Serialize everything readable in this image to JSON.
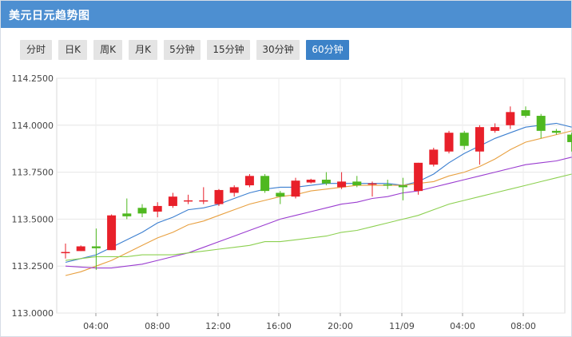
{
  "title": "美元日元趋势图",
  "tabs": [
    {
      "label": "分时",
      "active": false
    },
    {
      "label": "日K",
      "active": false
    },
    {
      "label": "周K",
      "active": false
    },
    {
      "label": "月K",
      "active": false
    },
    {
      "label": "5分钟",
      "active": false
    },
    {
      "label": "15分钟",
      "active": false
    },
    {
      "label": "30分钟",
      "active": false
    },
    {
      "label": "60分钟",
      "active": true
    }
  ],
  "colors": {
    "header": "#4d8fd1",
    "active_tab": "#3c82c8",
    "up": "#e8202a",
    "down": "#4fb820",
    "ma5": "#3c7fd0",
    "ma10": "#e8a040",
    "ma20": "#9a3cd0",
    "ma30": "#8cd050"
  },
  "chart_data": {
    "type": "candlestick",
    "ylim": [
      113.0,
      114.25
    ],
    "yticks": [
      "114.2500",
      "114.0000",
      "113.7500",
      "113.5000",
      "113.2500",
      "113.0000"
    ],
    "xticks": [
      "04:00",
      "08:00",
      "12:00",
      "16:00",
      "20:00",
      "11/09",
      "04:00",
      "08:00"
    ],
    "candles": [
      {
        "o": 113.325,
        "c": 113.325,
        "h": 113.37,
        "l": 113.29
      },
      {
        "o": 113.33,
        "c": 113.355,
        "h": 113.36,
        "l": 113.33
      },
      {
        "o": 113.355,
        "c": 113.345,
        "h": 113.45,
        "l": 113.23
      },
      {
        "o": 113.335,
        "c": 113.52,
        "h": 113.525,
        "l": 113.335
      },
      {
        "o": 113.53,
        "c": 113.515,
        "h": 113.61,
        "l": 113.5
      },
      {
        "o": 113.56,
        "c": 113.53,
        "h": 113.58,
        "l": 113.51
      },
      {
        "o": 113.54,
        "c": 113.57,
        "h": 113.59,
        "l": 113.51
      },
      {
        "o": 113.57,
        "c": 113.62,
        "h": 113.64,
        "l": 113.56
      },
      {
        "o": 113.6,
        "c": 113.6,
        "h": 113.63,
        "l": 113.58
      },
      {
        "o": 113.6,
        "c": 113.6,
        "h": 113.67,
        "l": 113.58
      },
      {
        "o": 113.58,
        "c": 113.655,
        "h": 113.66,
        "l": 113.57
      },
      {
        "o": 113.64,
        "c": 113.67,
        "h": 113.68,
        "l": 113.62
      },
      {
        "o": 113.68,
        "c": 113.73,
        "h": 113.74,
        "l": 113.67
      },
      {
        "o": 113.73,
        "c": 113.65,
        "h": 113.74,
        "l": 113.64
      },
      {
        "o": 113.64,
        "c": 113.62,
        "h": 113.65,
        "l": 113.58
      },
      {
        "o": 113.62,
        "c": 113.705,
        "h": 113.72,
        "l": 113.61
      },
      {
        "o": 113.695,
        "c": 113.71,
        "h": 113.715,
        "l": 113.69
      },
      {
        "o": 113.71,
        "c": 113.69,
        "h": 113.75,
        "l": 113.68
      },
      {
        "o": 113.67,
        "c": 113.7,
        "h": 113.75,
        "l": 113.66
      },
      {
        "o": 113.7,
        "c": 113.68,
        "h": 113.73,
        "l": 113.67
      },
      {
        "o": 113.69,
        "c": 113.69,
        "h": 113.7,
        "l": 113.62
      },
      {
        "o": 113.685,
        "c": 113.68,
        "h": 113.71,
        "l": 113.66
      },
      {
        "o": 113.68,
        "c": 113.67,
        "h": 113.72,
        "l": 113.6
      },
      {
        "o": 113.65,
        "c": 113.8,
        "h": 113.8,
        "l": 113.63
      },
      {
        "o": 113.79,
        "c": 113.87,
        "h": 113.88,
        "l": 113.78
      },
      {
        "o": 113.86,
        "c": 113.96,
        "h": 113.97,
        "l": 113.85
      },
      {
        "o": 113.96,
        "c": 113.89,
        "h": 113.97,
        "l": 113.87
      },
      {
        "o": 113.86,
        "c": 113.99,
        "h": 114.0,
        "l": 113.79
      },
      {
        "o": 113.97,
        "c": 113.99,
        "h": 114.01,
        "l": 113.96
      },
      {
        "o": 114.0,
        "c": 114.07,
        "h": 114.1,
        "l": 113.98
      },
      {
        "o": 114.08,
        "c": 114.05,
        "h": 114.1,
        "l": 114.04
      },
      {
        "o": 114.05,
        "c": 113.97,
        "h": 114.06,
        "l": 113.93
      },
      {
        "o": 113.97,
        "c": 113.96,
        "h": 113.98,
        "l": 113.95
      },
      {
        "o": 113.95,
        "c": 113.91,
        "h": 113.96,
        "l": 113.86
      }
    ],
    "series": [
      {
        "key": "ma5",
        "values": [
          113.27,
          113.29,
          113.31,
          113.35,
          113.39,
          113.43,
          113.48,
          113.51,
          113.55,
          113.56,
          113.58,
          113.61,
          113.64,
          113.66,
          113.67,
          113.67,
          113.68,
          113.69,
          113.69,
          113.69,
          113.69,
          113.69,
          113.68,
          113.7,
          113.74,
          113.8,
          113.85,
          113.89,
          113.93,
          113.96,
          113.99,
          114.0,
          114.01,
          113.99
        ]
      },
      {
        "key": "ma10",
        "values": [
          113.2,
          113.22,
          113.25,
          113.28,
          113.32,
          113.36,
          113.4,
          113.43,
          113.47,
          113.49,
          113.52,
          113.55,
          113.58,
          113.6,
          113.62,
          113.63,
          113.65,
          113.66,
          113.67,
          113.68,
          113.68,
          113.68,
          113.68,
          113.69,
          113.7,
          113.73,
          113.75,
          113.78,
          113.82,
          113.87,
          113.91,
          113.93,
          113.95,
          113.97
        ]
      },
      {
        "key": "ma20",
        "values": [
          113.25,
          113.245,
          113.24,
          113.24,
          113.25,
          113.26,
          113.28,
          113.3,
          113.32,
          113.35,
          113.38,
          113.41,
          113.44,
          113.47,
          113.5,
          113.52,
          113.54,
          113.56,
          113.58,
          113.59,
          113.61,
          113.62,
          113.64,
          113.65,
          113.67,
          113.69,
          113.71,
          113.73,
          113.75,
          113.77,
          113.79,
          113.8,
          113.81,
          113.83
        ]
      },
      {
        "key": "ma30",
        "values": [
          113.28,
          113.29,
          113.3,
          113.3,
          113.3,
          113.31,
          113.31,
          113.31,
          113.32,
          113.33,
          113.34,
          113.35,
          113.36,
          113.38,
          113.38,
          113.39,
          113.4,
          113.41,
          113.43,
          113.44,
          113.46,
          113.48,
          113.5,
          113.52,
          113.55,
          113.58,
          113.6,
          113.62,
          113.64,
          113.66,
          113.68,
          113.7,
          113.72,
          113.74
        ]
      }
    ]
  }
}
